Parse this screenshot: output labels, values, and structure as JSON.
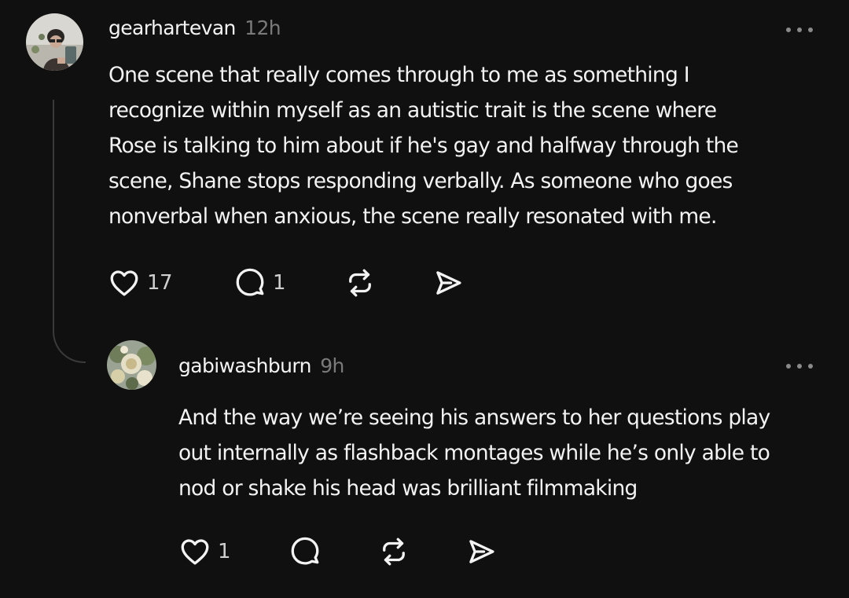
{
  "thread": {
    "comments": [
      {
        "username": "gearhartevan",
        "time": "12h",
        "lines": [
          "One scene that really comes through to me as something I",
          "recognize within myself as an autistic trait is the scene where",
          "Rose is talking to him about if he's gay and halfway through the",
          "scene, Shane stops responding verbally. As someone who goes",
          "nonverbal when anxious, the scene really resonated with me."
        ],
        "likes": "17",
        "replies": "1",
        "icons": [
          "heart-icon",
          "comment-icon",
          "repost-icon",
          "share-icon",
          "more-icon"
        ]
      },
      {
        "username": "gabiwashburn",
        "time": "9h",
        "lines": [
          "And the way we’re seeing his answers to her questions play",
          "out internally as flashback montages while he’s only able to",
          "nod or shake his head was brilliant filmmaking"
        ],
        "likes": "1",
        "replies": "",
        "icons": [
          "heart-icon",
          "comment-icon",
          "repost-icon",
          "share-icon",
          "more-icon"
        ]
      }
    ]
  },
  "colors": {
    "background": "#101010",
    "text": "#f3f3f3",
    "muted": "#7a7a7a",
    "thread_line": "#3a3a3a"
  }
}
